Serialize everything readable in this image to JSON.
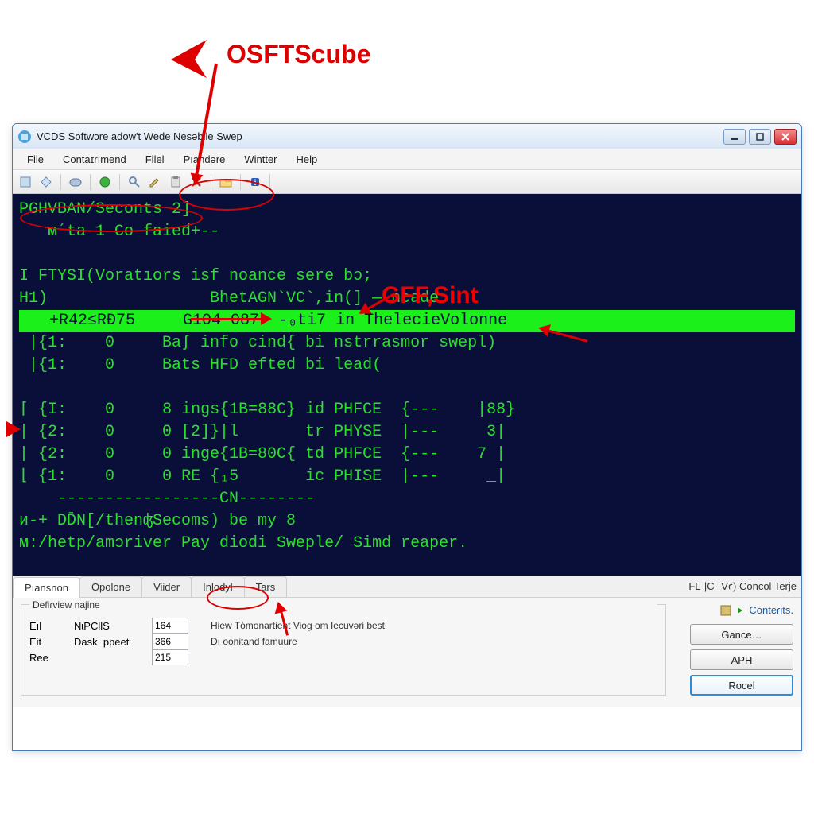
{
  "annotations": {
    "top_label": "OSFTScube",
    "gff_label": "GFF,Sint"
  },
  "window": {
    "title": "VCDS Softwɔre adow't Wede Nesəbile Swep"
  },
  "menu": {
    "items": [
      "File",
      "Contaɪrımend",
      "Filel",
      "Pıandǝre",
      "Wintter",
      "Help"
    ]
  },
  "terminal": {
    "lines": [
      "PGHVBAN/Seconts 2]",
      "   ᴍˊta 1 Co faied+--",
      "",
      "I FTYSI(Voratıors isf noance sere bɔ;",
      "H1)                 BhetAGN`VC`,in(] — ncade"
    ],
    "highlight": "   +R42≤RĐ75     G104 087  -₀ti7 in ThelecieVolonne",
    "lines2": [
      " |{1:    0     Baʃ info cind{ bi nstrrasmor swepl)",
      " |{1:    0     Bats HFD efted bi lead(",
      "",
      "⌈ {I:    0     8 ings{1B=88C} id PHFCE  {---    |88}",
      "| {2:    0     0 [2]}|l       tr PHYSE  |---     3|",
      "| {2:    0     0 inge{1B=80C{ td PHFCE  {---    7 |",
      "⌊ {1:    0     0 RE {₁5       ic PHISE  |---     _|",
      "    -----------------CN--------",
      "ᴎ-+ DD̄N[/thenʤSecoms) be my 8",
      "ᴍ:/hetp/amɔriver Pay diodi Sweple/ Simd reaper."
    ]
  },
  "tabs": {
    "items": [
      "Pıansnon",
      "Opolone",
      "Viider",
      "Inlodyl",
      "Tars"
    ],
    "right_label": "FL-|C--Vꜥ) Concol Terje"
  },
  "panel": {
    "group_label": "Defiɾview najine",
    "rows": [
      {
        "label": "Eıl",
        "label2": "NɩPCllS",
        "value": "164",
        "note": "Hiew Tȯmonartient Viog om Iecuvəri best"
      },
      {
        "label": "Eit",
        "label2": "Dask, ppeet",
        "value": "366",
        "note": "Dı oonɨtand famuure"
      },
      {
        "label": "Ree",
        "label2": "",
        "value": "215",
        "note": ""
      }
    ]
  },
  "buttons": {
    "contents": "Conteɾits.",
    "gance": "Gance…",
    "aph": "APH",
    "rocel": "Rocel"
  }
}
